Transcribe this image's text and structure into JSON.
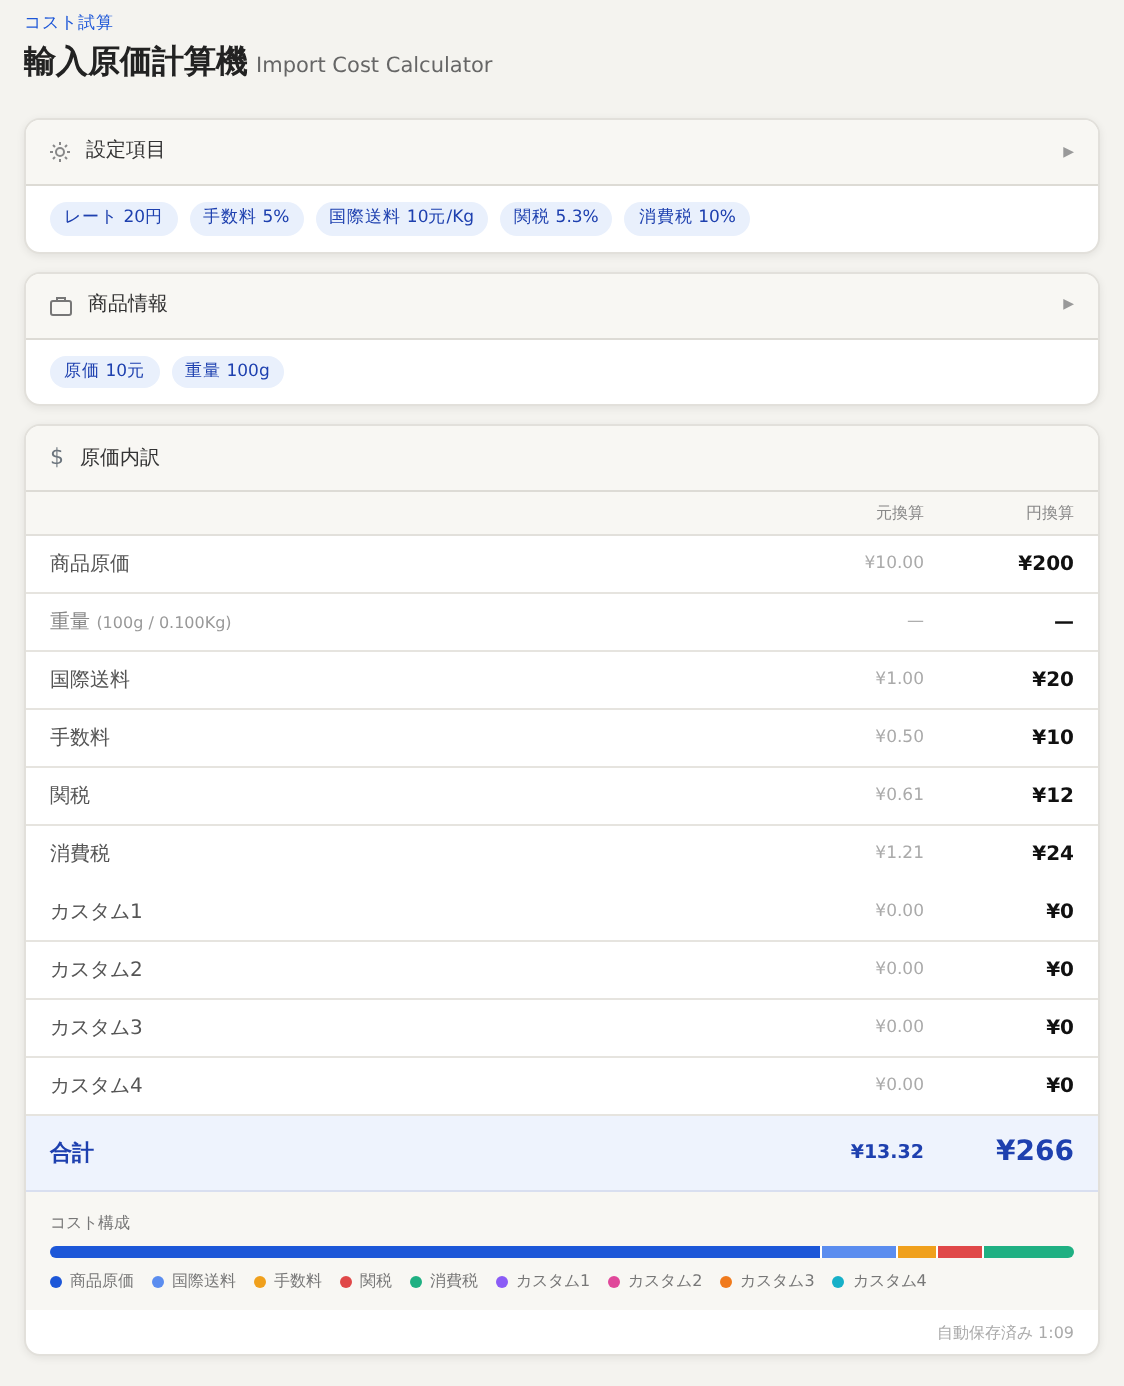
{
  "header": {
    "eyebrow": "コスト試算",
    "title": "輸入原価計算機",
    "subtitle": "Import Cost Calculator"
  },
  "settings": {
    "title": "設定項目",
    "toggle": "▶",
    "expanded": false,
    "chips": [
      "レート 20円",
      "手数料 5%",
      "国際送料 10元/Kg",
      "関税 5.3%",
      "消費税 10%"
    ]
  },
  "product": {
    "title": "商品情報",
    "toggle": "▶",
    "expanded": false,
    "chips": [
      "原価 10元",
      "重量 100g"
    ]
  },
  "breakdown": {
    "title": "原価内訳",
    "icon_glyph": "$",
    "columns": [
      "元換算",
      "円換算"
    ],
    "rows": [
      {
        "kind": "item",
        "label": "商品原価",
        "cny": "¥10.00",
        "jpy": "¥200"
      },
      {
        "kind": "info",
        "label": "重量",
        "note": "(100g / 0.100Kg)",
        "cny": "—",
        "jpy": "—"
      },
      {
        "kind": "item",
        "label": "国際送料",
        "cny": "¥1.00",
        "jpy": "¥20"
      },
      {
        "kind": "item",
        "label": "手数料",
        "cny": "¥0.50",
        "jpy": "¥10"
      },
      {
        "kind": "item",
        "label": "関税",
        "cny": "¥0.61",
        "jpy": "¥12"
      },
      {
        "kind": "item",
        "label": "消費税",
        "cny": "¥1.21",
        "jpy": "¥24"
      },
      {
        "kind": "custom",
        "label": "カスタム1",
        "cny": "¥0.00",
        "jpy": "¥0"
      },
      {
        "kind": "custom",
        "label": "カスタム2",
        "cny": "¥0.00",
        "jpy": "¥0"
      },
      {
        "kind": "custom",
        "label": "カスタム3",
        "cny": "¥0.00",
        "jpy": "¥0"
      },
      {
        "kind": "custom",
        "label": "カスタム4",
        "cny": "¥0.00",
        "jpy": "¥0"
      }
    ],
    "total": {
      "label": "合計",
      "cny": "¥13.32",
      "jpy": "¥266"
    },
    "composition": {
      "title": "コスト構成",
      "segments": [
        {
          "color": "#1d57d8"
        },
        {
          "color": "#5b8def"
        },
        {
          "color": "#f0a01c"
        },
        {
          "color": "#e04848"
        },
        {
          "color": "#1fb082"
        }
      ],
      "legend": [
        {
          "label": "商品原価",
          "color": "#1d57d8"
        },
        {
          "label": "国際送料",
          "color": "#5b8def"
        },
        {
          "label": "手数料",
          "color": "#f0a01c"
        },
        {
          "label": "関税",
          "color": "#e04848"
        },
        {
          "label": "消費税",
          "color": "#1fb082"
        },
        {
          "label": "カスタム1",
          "color": "#8b5cf6"
        },
        {
          "label": "カスタム2",
          "color": "#e0489a"
        },
        {
          "label": "カスタム3",
          "color": "#f07a1c"
        },
        {
          "label": "カスタム4",
          "color": "#17b0c8"
        }
      ]
    },
    "autosave": "自動保存済み 1:09"
  }
}
